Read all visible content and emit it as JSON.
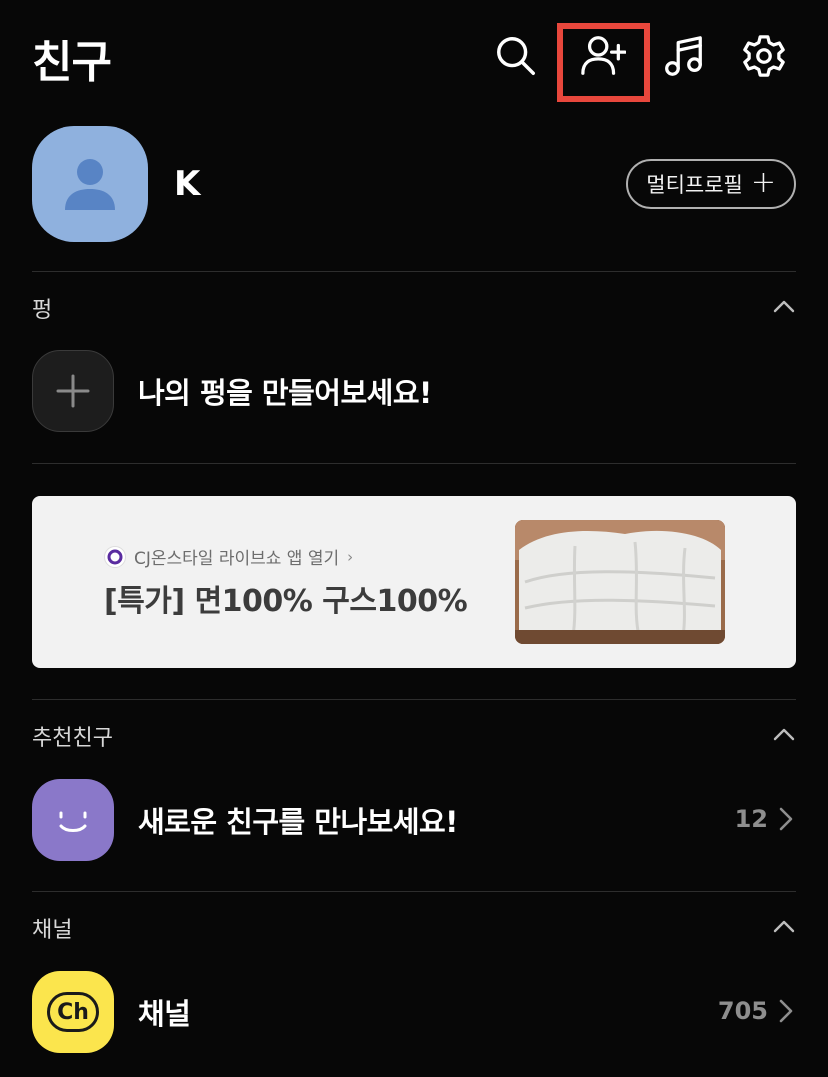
{
  "header": {
    "title": "친구",
    "icons": [
      "search-icon",
      "add-friend-icon",
      "music-icon",
      "settings-icon"
    ]
  },
  "profile": {
    "name": "K",
    "multi_profile_label": "멀티프로필"
  },
  "pyeong": {
    "section_title": "펑",
    "create_label": "나의 펑을 만들어보세요!"
  },
  "ad": {
    "source": "CJ온스타일 라이브쇼 앱 열기",
    "title": "[특가] 면100% 구스100%"
  },
  "recommended": {
    "section_title": "추천친구",
    "label": "새로운 친구를 만나보세요!",
    "count": "12"
  },
  "channel": {
    "section_title": "채널",
    "label": "채널",
    "count": "705",
    "logo_text": "Ch"
  },
  "colors": {
    "background": "#070707",
    "highlight": "#e8473c",
    "profile_avatar": "#8fb1de",
    "recommend_avatar": "#8a78c9",
    "channel_logo": "#fbe54d"
  }
}
